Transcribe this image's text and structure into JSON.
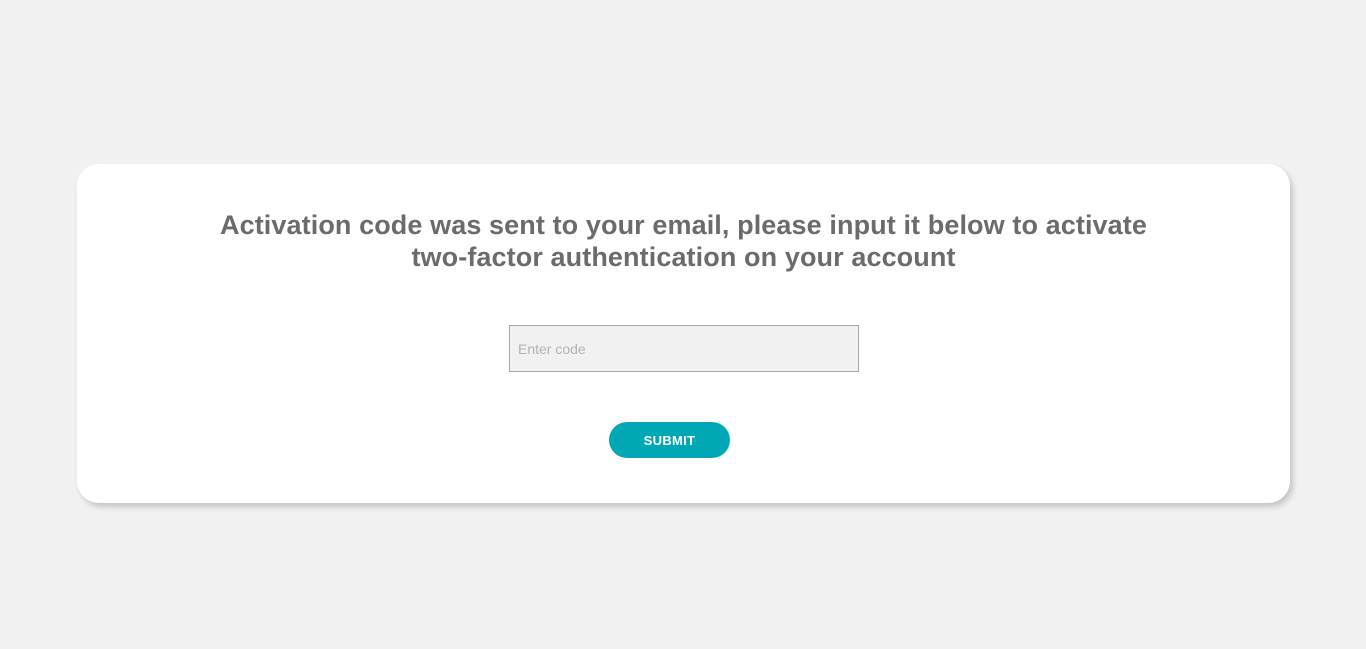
{
  "heading": {
    "line1": "Activation code was sent to your email, please input it below to activate",
    "line2": "two-factor authentication on your account"
  },
  "code_field": {
    "placeholder": "Enter code",
    "value": ""
  },
  "submit_button": {
    "label": "SUBMIT"
  },
  "colors": {
    "page_background": "#f1f1f1",
    "card_background": "#ffffff",
    "heading_text": "#6b6b6b",
    "accent": "#00a8b5"
  }
}
